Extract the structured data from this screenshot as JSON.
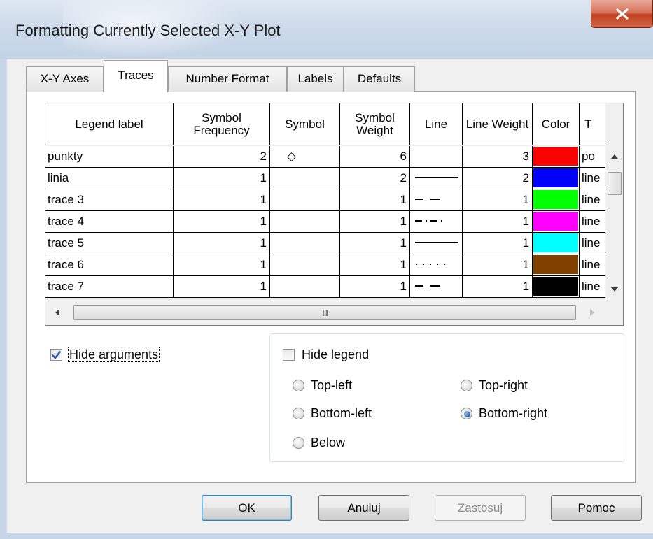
{
  "window": {
    "title": "Formatting Currently Selected X-Y Plot"
  },
  "tabs": [
    {
      "label": "X-Y Axes"
    },
    {
      "label": "Traces"
    },
    {
      "label": "Number Format"
    },
    {
      "label": "Labels"
    },
    {
      "label": "Defaults"
    }
  ],
  "active_tab": "Traces",
  "grid": {
    "columns": [
      "Legend label",
      "Symbol Frequency",
      "Symbol",
      "Symbol Weight",
      "Line",
      "Line Weight",
      "Color",
      "T"
    ],
    "rows": [
      {
        "label": "punkty",
        "freq": "2",
        "symbol": "◇",
        "weight": "6",
        "line": "none",
        "line_weight": "3",
        "color": "#ff0000",
        "type": "po"
      },
      {
        "label": "linia",
        "freq": "1",
        "symbol": "",
        "weight": "2",
        "line": "solid",
        "line_weight": "2",
        "color": "#0000ff",
        "type": "line"
      },
      {
        "label": "trace 3",
        "freq": "1",
        "symbol": "",
        "weight": "1",
        "line": "dash",
        "line_weight": "1",
        "color": "#00ff00",
        "type": "line"
      },
      {
        "label": "trace 4",
        "freq": "1",
        "symbol": "",
        "weight": "1",
        "line": "dash-dot",
        "line_weight": "1",
        "color": "#ff00ff",
        "type": "line"
      },
      {
        "label": "trace 5",
        "freq": "1",
        "symbol": "",
        "weight": "1",
        "line": "solid",
        "line_weight": "1",
        "color": "#00ffff",
        "type": "line"
      },
      {
        "label": "trace 6",
        "freq": "1",
        "symbol": "",
        "weight": "1",
        "line": "dot",
        "line_weight": "1",
        "color": "#804000",
        "type": "line"
      },
      {
        "label": "trace 7",
        "freq": "1",
        "symbol": "",
        "weight": "1",
        "line": "dash",
        "line_weight": "1",
        "color": "#000000",
        "type": "line"
      }
    ],
    "hscroll_glyph": "III"
  },
  "options": {
    "hide_arguments": {
      "label": "Hide arguments",
      "checked": true
    },
    "hide_legend": {
      "label": "Hide legend",
      "checked": false
    },
    "legend_positions": [
      {
        "label": "Top-left",
        "selected": false
      },
      {
        "label": "Top-right",
        "selected": false
      },
      {
        "label": "Bottom-left",
        "selected": false
      },
      {
        "label": "Bottom-right",
        "selected": true
      },
      {
        "label": "Below",
        "selected": false
      }
    ]
  },
  "buttons": {
    "ok": "OK",
    "cancel": "Anuluj",
    "apply": "Zastosuj",
    "help": "Pomoc"
  },
  "icons": [
    "close-icon",
    "scroll-up-icon",
    "scroll-down-icon",
    "scroll-left-icon",
    "scroll-right-icon",
    "checkmark-icon"
  ]
}
